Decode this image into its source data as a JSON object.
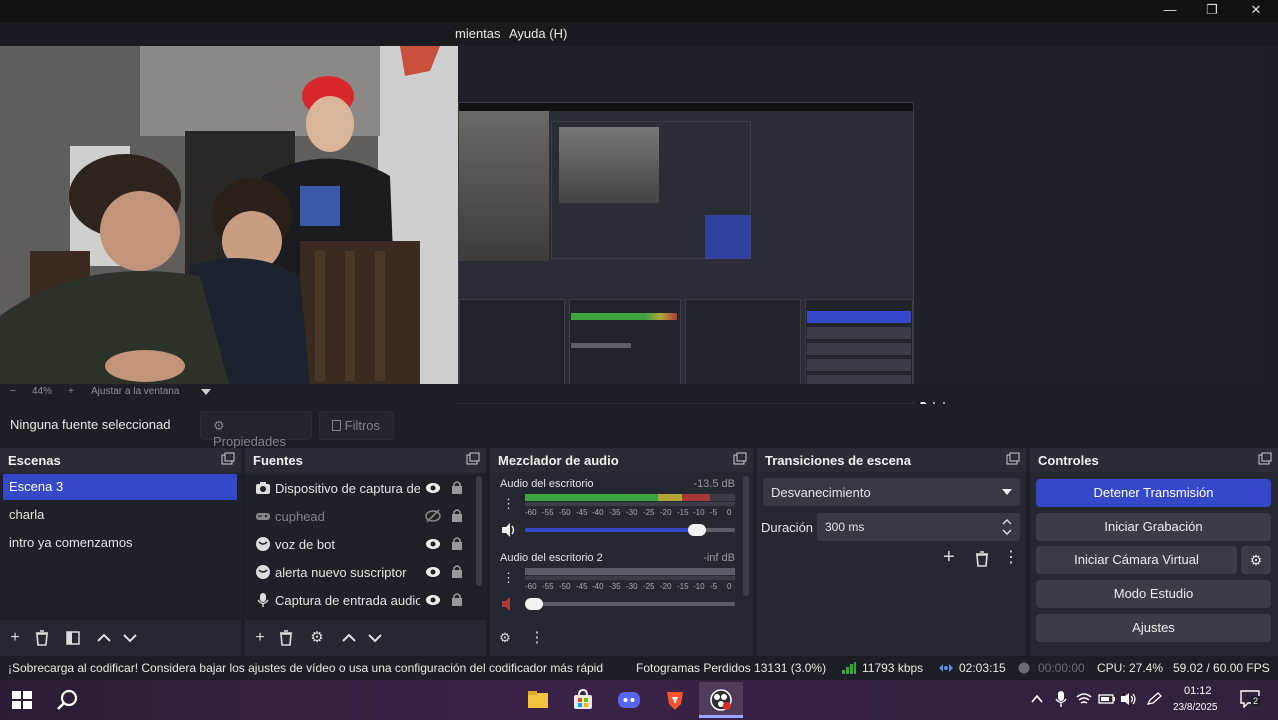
{
  "window": {
    "minimize": "—",
    "maximize": "❐",
    "close": "✕"
  },
  "menubar": {
    "items": [
      "mientas",
      "Ayuda (H)"
    ]
  },
  "preview": {
    "zoom_minus": "−",
    "zoom_value": "44%",
    "zoom_plus": "+",
    "fit_label": "Ajustar a la ventana"
  },
  "source_toolbar": {
    "no_source": "Ninguna fuente seleccionad",
    "properties": "Propiedades",
    "filters": "Filtros"
  },
  "scenes": {
    "title": "Escenas",
    "items": [
      "Escena 3",
      "charla",
      "intro ya comenzamos"
    ],
    "selected_index": 0
  },
  "sources": {
    "title": "Fuentes",
    "items": [
      {
        "label": "Dispositivo de captura de",
        "icon": "camera-icon",
        "visible": true
      },
      {
        "label": "cuphead",
        "icon": "gamepad-icon",
        "visible": false
      },
      {
        "label": "voz de bot",
        "icon": "browser-icon",
        "visible": true
      },
      {
        "label": "alerta nuevo suscriptor",
        "icon": "browser-icon",
        "visible": true
      },
      {
        "label": "Captura de entrada audio",
        "icon": "microphone-icon",
        "visible": true
      }
    ]
  },
  "mixer": {
    "title": "Mezclador de audio",
    "channels": [
      {
        "name": "Audio del escritorio",
        "db": "-13.5 dB",
        "level": 0.88,
        "volume": 0.82,
        "muted": false
      },
      {
        "name": "Audio del escritorio 2",
        "db": "-inf dB",
        "level": 0.0,
        "volume": 0.03,
        "muted": true
      }
    ],
    "scale": [
      "-60",
      "-55",
      "-50",
      "-45",
      "-40",
      "-35",
      "-30",
      "-25",
      "-20",
      "-15",
      "-10",
      "-5",
      "0"
    ]
  },
  "transitions": {
    "title": "Transiciones de escena",
    "selected": "Desvanecimiento",
    "duration_label": "Duración",
    "duration_value": "300 ms"
  },
  "controls": {
    "title": "Controles",
    "stop_stream": "Detener Transmisión",
    "start_recording": "Iniciar Grabación",
    "start_virtual_cam": "Iniciar Cámara Virtual",
    "studio_mode": "Modo Estudio",
    "settings": "Ajustes"
  },
  "status": {
    "warning": "¡Sobrecarga al codificar! Considera bajar los ajustes de vídeo o usa una configuración del codificador más rápid",
    "dropped": "Fotogramas Perdidos 13131 (3.0%)",
    "bitrate": "11793 kbps",
    "stream_time": "02:03:15",
    "rec_time": "00:00:00",
    "cpu": "CPU: 27.4%",
    "fps": "59.02 / 60.00 FPS"
  },
  "taskbar": {
    "time": "01:12",
    "date": "23/8/2025",
    "notifications": "2"
  },
  "colors": {
    "accent": "#3548c7",
    "bg": "#1d1f26",
    "panel": "#262831",
    "meter_green": "#3fa33f",
    "meter_yellow": "#b3a43a",
    "meter_red": "#a83838"
  }
}
